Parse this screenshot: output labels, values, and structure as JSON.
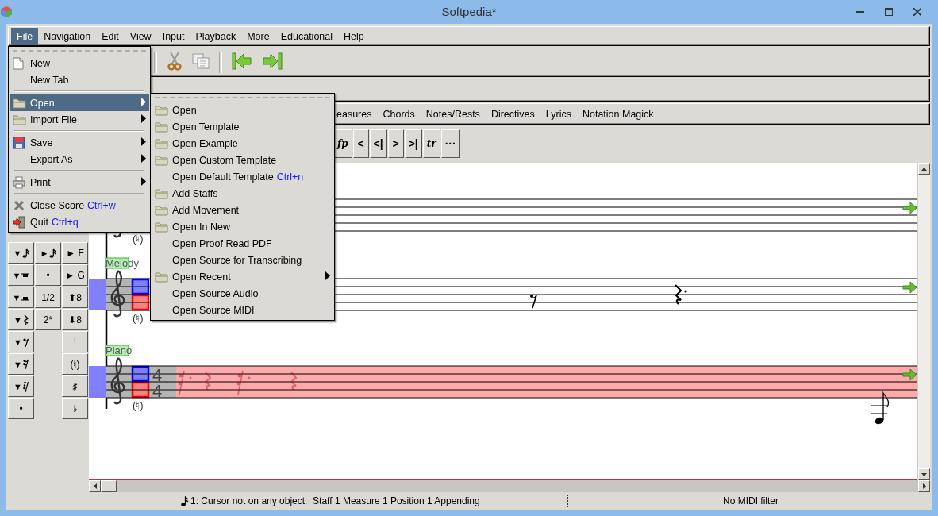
{
  "window": {
    "title": "Softpedia*"
  },
  "menubar": [
    {
      "label": "File",
      "selected": true
    },
    {
      "label": "Navigation",
      "selected": false
    },
    {
      "label": "Edit",
      "selected": false
    },
    {
      "label": "View",
      "selected": false
    },
    {
      "label": "Input",
      "selected": false
    },
    {
      "label": "Playback",
      "selected": false
    },
    {
      "label": "More",
      "selected": false
    },
    {
      "label": "Educational",
      "selected": false
    },
    {
      "label": "Help",
      "selected": false
    }
  ],
  "file_menu": {
    "items": [
      {
        "kind": "document",
        "label": "New",
        "has_submenu": false,
        "selected": false
      },
      {
        "kind": "plain",
        "label": "New Tab",
        "has_submenu": false,
        "selected": false
      },
      {
        "kind": "separator"
      },
      {
        "kind": "folder",
        "label": "Open",
        "has_submenu": true,
        "selected": true
      },
      {
        "kind": "folder",
        "label": "Import File",
        "has_submenu": true,
        "selected": false
      },
      {
        "kind": "separator"
      },
      {
        "kind": "save",
        "label": "Save",
        "has_submenu": true,
        "selected": false
      },
      {
        "kind": "plain",
        "label": "Export As",
        "has_submenu": true,
        "selected": false
      },
      {
        "kind": "separator"
      },
      {
        "kind": "printer",
        "label": "Print",
        "has_submenu": true,
        "selected": false
      },
      {
        "kind": "separator"
      },
      {
        "kind": "close",
        "label": "Close Score",
        "shortcut": "Ctrl+w",
        "has_submenu": false,
        "selected": false
      },
      {
        "kind": "quit",
        "label": "Quit",
        "shortcut": "Ctrl+q",
        "has_submenu": false,
        "selected": false
      }
    ]
  },
  "open_submenu": {
    "items": [
      {
        "kind": "folder",
        "label": "Open",
        "has_submenu": false,
        "selected": false
      },
      {
        "kind": "folder",
        "label": "Open Template",
        "has_submenu": false,
        "selected": false
      },
      {
        "kind": "folder",
        "label": "Open Example",
        "has_submenu": false,
        "selected": false
      },
      {
        "kind": "folder",
        "label": "Open Custom Template",
        "has_submenu": false,
        "selected": false
      },
      {
        "kind": "plain",
        "label": "Open Default Template",
        "shortcut": "Ctrl+n",
        "has_submenu": false,
        "selected": false
      },
      {
        "kind": "folder",
        "label": "Add Staffs",
        "has_submenu": false,
        "selected": false
      },
      {
        "kind": "folder",
        "label": "Add Movement",
        "has_submenu": false,
        "selected": false
      },
      {
        "kind": "folder",
        "label": "Open In New",
        "has_submenu": false,
        "selected": false
      },
      {
        "kind": "plain",
        "label": "Open Proof Read PDF",
        "has_submenu": false,
        "selected": false
      },
      {
        "kind": "plain",
        "label": "Open Source for Transcribing",
        "has_submenu": false,
        "selected": false
      },
      {
        "kind": "folder",
        "label": "Open Recent",
        "has_submenu": true,
        "selected": false
      },
      {
        "kind": "plain",
        "label": "Open Source Audio",
        "has_submenu": false,
        "selected": false
      },
      {
        "kind": "plain",
        "label": "Open Source MIDI",
        "has_submenu": false,
        "selected": false
      }
    ]
  },
  "toolbar": [
    {
      "kind": "separator"
    },
    {
      "kind": "cut"
    },
    {
      "kind": "copy"
    },
    {
      "kind": "separator"
    },
    {
      "kind": "first"
    },
    {
      "kind": "last"
    }
  ],
  "notation_menus": [
    "easures",
    "Chords",
    "Notes/Rests",
    "Directives",
    "Lyrics",
    "Notation Magick"
  ],
  "ornament_buttons": [
    {
      "label": "fp",
      "kind": "dynamic"
    },
    {
      "label": "<",
      "kind": "text"
    },
    {
      "label": "<|",
      "kind": "text"
    },
    {
      "label": ">",
      "kind": "text"
    },
    {
      "label": ">|",
      "kind": "text"
    },
    {
      "label": "tr",
      "kind": "dynamic"
    },
    {
      "label": "···",
      "kind": "text"
    }
  ],
  "duration_palette": {
    "columns": [
      [
        {
          "label": "▼",
          "kind": "sixteenth-note"
        },
        {
          "label": "▼",
          "kind": "whole-rest"
        },
        {
          "label": "▼",
          "kind": "half-rest"
        },
        {
          "label": "▼",
          "kind": "quarter-rest"
        },
        {
          "label": "▼",
          "kind": "eighth-rest"
        },
        {
          "label": "▼",
          "kind": "sixteenth-rest"
        },
        {
          "label": "▼",
          "kind": "thirty-second-rest"
        },
        {
          "label": "•",
          "kind": "text"
        }
      ],
      [
        {
          "label": "►",
          "kind": "sixteenth-note"
        },
        {
          "label": "•",
          "kind": "text"
        },
        {
          "label": "1/2",
          "kind": "text"
        },
        {
          "label": "2*",
          "kind": "text"
        }
      ],
      [
        {
          "label": "► F",
          "kind": "text"
        },
        {
          "label": "► G",
          "kind": "text"
        },
        {
          "label": "⬆8",
          "kind": "text"
        },
        {
          "label": "⬇8",
          "kind": "text"
        },
        {
          "label": "!",
          "kind": "text"
        },
        {
          "label": "(♮)",
          "kind": "text"
        },
        {
          "label": "♯",
          "kind": "text"
        },
        {
          "label": "♭",
          "kind": "text"
        }
      ]
    ]
  },
  "score": {
    "staffs": [
      {
        "cautionary": "(♮)",
        "current": false
      },
      {
        "label": "Melody",
        "cautionary": "(♮)",
        "markers": true,
        "current": false,
        "objects": [
          {
            "kind": "eighth-rest"
          },
          {
            "kind": "dotted-quarter-rest"
          }
        ]
      },
      {
        "label": "Piano",
        "cautionary": "(♮)",
        "time_signature": [
          "4",
          "4"
        ],
        "markers": true,
        "current": true,
        "objects": [
          {
            "kind": "ghost-eighth-rest"
          },
          {
            "kind": "ghost-quarter-rest"
          },
          {
            "kind": "ghost-eighth-rest"
          },
          {
            "kind": "ghost-quarter-rest"
          },
          {
            "kind": "note"
          }
        ]
      }
    ]
  },
  "status_bar": {
    "message": "1: Cursor not on any object:  Staff 1 Measure 1 Position 1 Appending",
    "midi": "No MIDI filter"
  }
}
